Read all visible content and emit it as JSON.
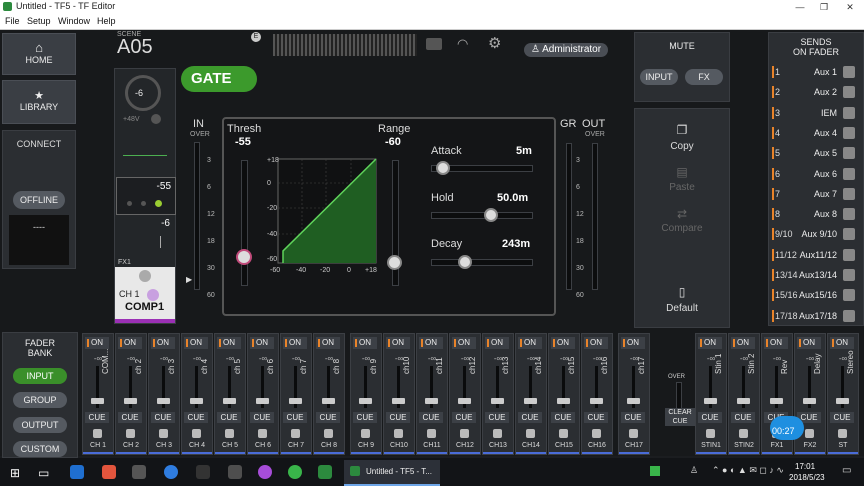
{
  "window": {
    "title": "Untitled - TF5 - TF Editor"
  },
  "menu": [
    "File",
    "Setup",
    "Window",
    "Help"
  ],
  "nav": {
    "home": "HOME",
    "library": "LIBRARY",
    "connect": "CONNECT",
    "offline": "OFFLINE",
    "dashes": "----"
  },
  "scene": {
    "label": "SCENE",
    "name": "A05"
  },
  "header": {
    "user": "Administrator"
  },
  "channel": {
    "gain": "-6",
    "phantom": "+48V",
    "gate_value": "-55",
    "comp_value": "-6",
    "fx": "FX1",
    "name": "CH 1",
    "comp_label": "COMP1"
  },
  "gate": {
    "title": "GATE",
    "in_label": "IN",
    "over": "OVER",
    "gr": "GR",
    "out": "OUT",
    "thresh_label": "Thresh",
    "thresh": "-55",
    "range_label": "Range",
    "range": "-60",
    "attack_label": "Attack",
    "attack": "5m",
    "attack_level": 0.05,
    "hold_label": "Hold",
    "hold": "50.0m",
    "hold_level": 0.6,
    "decay_label": "Decay",
    "decay": "243m",
    "decay_level": 0.3,
    "meter_scale": [
      "3",
      "6",
      "12",
      "18",
      "30",
      "60"
    ],
    "graph_y": [
      "+18",
      "0",
      "-20",
      "-40",
      "-60"
    ],
    "graph_x": [
      "-60",
      "-40",
      "-20",
      "0",
      "+18"
    ]
  },
  "mute": {
    "title": "MUTE",
    "input": "INPUT",
    "fx": "FX"
  },
  "actions": {
    "copy": "Copy",
    "paste": "Paste",
    "compare": "Compare",
    "default": "Default"
  },
  "sends": {
    "title": "SENDS",
    "subtitle": "ON FADER",
    "rows": [
      {
        "num": "1",
        "name": "Aux 1"
      },
      {
        "num": "2",
        "name": "Aux 2"
      },
      {
        "num": "3",
        "name": "IEM"
      },
      {
        "num": "4",
        "name": "Aux 4"
      },
      {
        "num": "5",
        "name": "Aux 5"
      },
      {
        "num": "6",
        "name": "Aux 6"
      },
      {
        "num": "7",
        "name": "Aux 7"
      },
      {
        "num": "8",
        "name": "Aux 8"
      },
      {
        "num": "9/10",
        "name": "Aux 9/10"
      },
      {
        "num": "11/12",
        "name": "Aux11/12"
      },
      {
        "num": "13/14",
        "name": "Aux13/14"
      },
      {
        "num": "15/16",
        "name": "Aux15/16"
      },
      {
        "num": "17/18",
        "name": "Aux17/18"
      }
    ]
  },
  "fader_bank": {
    "title": "FADER",
    "title2": "BANK",
    "input": "INPUT",
    "group": "GROUP",
    "output": "OUTPUT",
    "custom": "CUSTOM",
    "over": "OVER",
    "clear_cue": "CLEAR CUE"
  },
  "strips": [
    {
      "on": "ON",
      "inf": "-∞",
      "name": "COM...",
      "cue": "CUE",
      "label": "CH 1"
    },
    {
      "on": "ON",
      "inf": "-∞",
      "name": "ch 2",
      "cue": "CUE",
      "label": "CH 2"
    },
    {
      "on": "ON",
      "inf": "-∞",
      "name": "ch 3",
      "cue": "CUE",
      "label": "CH 3"
    },
    {
      "on": "ON",
      "inf": "-∞",
      "name": "ch 4",
      "cue": "CUE",
      "label": "CH 4"
    },
    {
      "on": "ON",
      "inf": "-∞",
      "name": "ch 5",
      "cue": "CUE",
      "label": "CH 5"
    },
    {
      "on": "ON",
      "inf": "-∞",
      "name": "ch 6",
      "cue": "CUE",
      "label": "CH 6"
    },
    {
      "on": "ON",
      "inf": "-∞",
      "name": "ch 7",
      "cue": "CUE",
      "label": "CH 7"
    },
    {
      "on": "ON",
      "inf": "-∞",
      "name": "ch 8",
      "cue": "CUE",
      "label": "CH 8"
    },
    {
      "on": "ON",
      "inf": "-∞",
      "name": "ch 9",
      "cue": "CUE",
      "label": "CH 9"
    },
    {
      "on": "ON",
      "inf": "-∞",
      "name": "ch10",
      "cue": "CUE",
      "label": "CH10"
    },
    {
      "on": "ON",
      "inf": "-∞",
      "name": "ch11",
      "cue": "CUE",
      "label": "CH11"
    },
    {
      "on": "ON",
      "inf": "-∞",
      "name": "ch12",
      "cue": "CUE",
      "label": "CH12"
    },
    {
      "on": "ON",
      "inf": "-∞",
      "name": "ch13",
      "cue": "CUE",
      "label": "CH13"
    },
    {
      "on": "ON",
      "inf": "-∞",
      "name": "ch14",
      "cue": "CUE",
      "label": "CH14"
    },
    {
      "on": "ON",
      "inf": "-∞",
      "name": "ch15",
      "cue": "CUE",
      "label": "CH15"
    },
    {
      "on": "ON",
      "inf": "-∞",
      "name": "ch16",
      "cue": "CUE",
      "label": "CH16"
    },
    {
      "on": "ON",
      "inf": "-∞",
      "name": "ch17",
      "cue": "CUE",
      "label": "CH17"
    },
    {
      "on": "ON",
      "inf": "-∞",
      "name": "Stin 1",
      "cue": "CUE",
      "label": "STIN1"
    },
    {
      "on": "ON",
      "inf": "-∞",
      "name": "Stin 2",
      "cue": "CUE",
      "label": "STIN2"
    },
    {
      "on": "ON",
      "inf": "-∞",
      "name": "Rev",
      "cue": "CUE",
      "label": "FX1"
    },
    {
      "on": "ON",
      "inf": "-∞",
      "name": "Delay",
      "cue": "CUE",
      "label": "FX2"
    },
    {
      "on": "ON",
      "inf": "-∞",
      "name": "Stereo",
      "cue": "CUE",
      "label": "ST"
    }
  ],
  "recording": {
    "time": "00:27"
  },
  "taskbar": {
    "app_title": "Untitled - TF5 - T...",
    "time": "17:01",
    "date": "2018/5/23"
  }
}
